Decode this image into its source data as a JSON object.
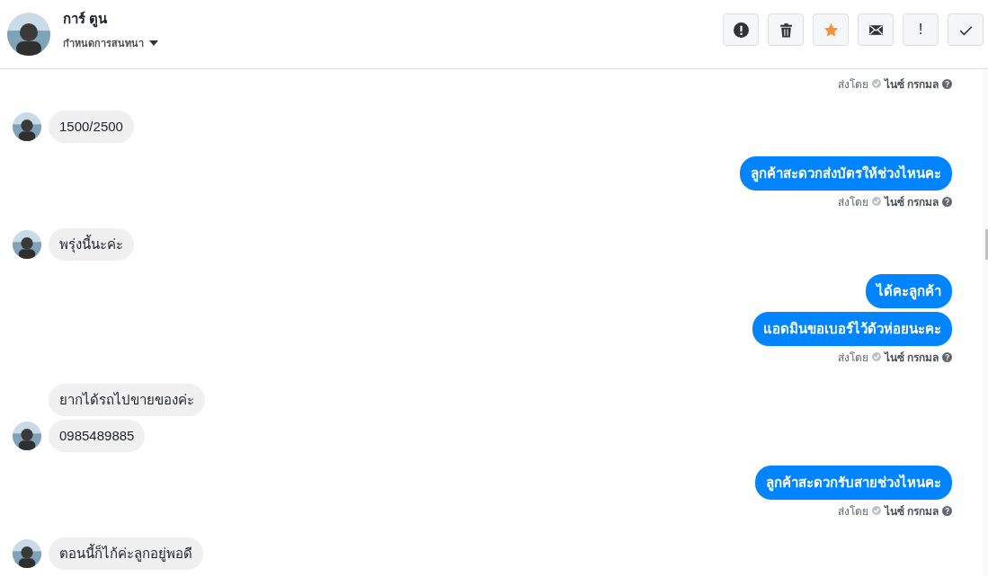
{
  "header": {
    "name": "การ์ ตูน",
    "subtitle": "กำหนดการสนทนา",
    "actions": [
      {
        "kind": "alert"
      },
      {
        "kind": "delete"
      },
      {
        "kind": "star"
      },
      {
        "kind": "mail"
      },
      {
        "kind": "text",
        "label": "!"
      },
      {
        "kind": "done"
      }
    ]
  },
  "thread": [
    {
      "kind": "caption",
      "prefix": "ส่งโดย",
      "sender": "ไนซ์ กรกมล"
    },
    {
      "kind": "incoming",
      "messages": [
        "1500/2500"
      ]
    },
    {
      "kind": "outgoing",
      "messages": [
        "ลูกค้าสะดวกส่งบัตรให้ช่วงไหนคะ"
      ]
    },
    {
      "kind": "caption",
      "prefix": "ส่งโดย",
      "sender": "ไนซ์ กรกมล"
    },
    {
      "kind": "incoming",
      "messages": [
        "พรุ่งนี้นะค่ะ"
      ]
    },
    {
      "kind": "outgoing",
      "messages": [
        "ได้คะลูกค้า",
        "แอดมินขอเบอร์ไว้ด้วห่อยนะคะ"
      ]
    },
    {
      "kind": "caption",
      "prefix": "ส่งโดย",
      "sender": "ไนซ์ กรกมล"
    },
    {
      "kind": "incoming",
      "messages": [
        "ยากได้รถไปขายของค่ะ",
        "0985489885"
      ]
    },
    {
      "kind": "outgoing",
      "messages": [
        "ลูกค้าสะดวกรับสายช่วงไหนคะ"
      ]
    },
    {
      "kind": "caption",
      "prefix": "ส่งโดย",
      "sender": "ไนซ์ กรกมล"
    },
    {
      "kind": "incoming",
      "messages": [
        "ตอนนี้ก็ไก้ค่ะลูกอยู่พอดี"
      ]
    }
  ]
}
